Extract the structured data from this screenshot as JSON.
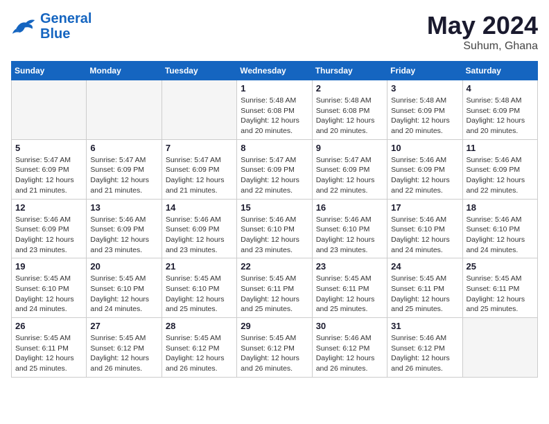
{
  "header": {
    "logo": {
      "line1": "General",
      "line2": "Blue"
    },
    "month": "May 2024",
    "location": "Suhum, Ghana"
  },
  "weekdays": [
    "Sunday",
    "Monday",
    "Tuesday",
    "Wednesday",
    "Thursday",
    "Friday",
    "Saturday"
  ],
  "weeks": [
    [
      {
        "day": "",
        "info": ""
      },
      {
        "day": "",
        "info": ""
      },
      {
        "day": "",
        "info": ""
      },
      {
        "day": "1",
        "info": "Sunrise: 5:48 AM\nSunset: 6:08 PM\nDaylight: 12 hours\nand 20 minutes."
      },
      {
        "day": "2",
        "info": "Sunrise: 5:48 AM\nSunset: 6:08 PM\nDaylight: 12 hours\nand 20 minutes."
      },
      {
        "day": "3",
        "info": "Sunrise: 5:48 AM\nSunset: 6:09 PM\nDaylight: 12 hours\nand 20 minutes."
      },
      {
        "day": "4",
        "info": "Sunrise: 5:48 AM\nSunset: 6:09 PM\nDaylight: 12 hours\nand 20 minutes."
      }
    ],
    [
      {
        "day": "5",
        "info": "Sunrise: 5:47 AM\nSunset: 6:09 PM\nDaylight: 12 hours\nand 21 minutes."
      },
      {
        "day": "6",
        "info": "Sunrise: 5:47 AM\nSunset: 6:09 PM\nDaylight: 12 hours\nand 21 minutes."
      },
      {
        "day": "7",
        "info": "Sunrise: 5:47 AM\nSunset: 6:09 PM\nDaylight: 12 hours\nand 21 minutes."
      },
      {
        "day": "8",
        "info": "Sunrise: 5:47 AM\nSunset: 6:09 PM\nDaylight: 12 hours\nand 22 minutes."
      },
      {
        "day": "9",
        "info": "Sunrise: 5:47 AM\nSunset: 6:09 PM\nDaylight: 12 hours\nand 22 minutes."
      },
      {
        "day": "10",
        "info": "Sunrise: 5:46 AM\nSunset: 6:09 PM\nDaylight: 12 hours\nand 22 minutes."
      },
      {
        "day": "11",
        "info": "Sunrise: 5:46 AM\nSunset: 6:09 PM\nDaylight: 12 hours\nand 22 minutes."
      }
    ],
    [
      {
        "day": "12",
        "info": "Sunrise: 5:46 AM\nSunset: 6:09 PM\nDaylight: 12 hours\nand 23 minutes."
      },
      {
        "day": "13",
        "info": "Sunrise: 5:46 AM\nSunset: 6:09 PM\nDaylight: 12 hours\nand 23 minutes."
      },
      {
        "day": "14",
        "info": "Sunrise: 5:46 AM\nSunset: 6:09 PM\nDaylight: 12 hours\nand 23 minutes."
      },
      {
        "day": "15",
        "info": "Sunrise: 5:46 AM\nSunset: 6:10 PM\nDaylight: 12 hours\nand 23 minutes."
      },
      {
        "day": "16",
        "info": "Sunrise: 5:46 AM\nSunset: 6:10 PM\nDaylight: 12 hours\nand 23 minutes."
      },
      {
        "day": "17",
        "info": "Sunrise: 5:46 AM\nSunset: 6:10 PM\nDaylight: 12 hours\nand 24 minutes."
      },
      {
        "day": "18",
        "info": "Sunrise: 5:46 AM\nSunset: 6:10 PM\nDaylight: 12 hours\nand 24 minutes."
      }
    ],
    [
      {
        "day": "19",
        "info": "Sunrise: 5:45 AM\nSunset: 6:10 PM\nDaylight: 12 hours\nand 24 minutes."
      },
      {
        "day": "20",
        "info": "Sunrise: 5:45 AM\nSunset: 6:10 PM\nDaylight: 12 hours\nand 24 minutes."
      },
      {
        "day": "21",
        "info": "Sunrise: 5:45 AM\nSunset: 6:10 PM\nDaylight: 12 hours\nand 25 minutes."
      },
      {
        "day": "22",
        "info": "Sunrise: 5:45 AM\nSunset: 6:11 PM\nDaylight: 12 hours\nand 25 minutes."
      },
      {
        "day": "23",
        "info": "Sunrise: 5:45 AM\nSunset: 6:11 PM\nDaylight: 12 hours\nand 25 minutes."
      },
      {
        "day": "24",
        "info": "Sunrise: 5:45 AM\nSunset: 6:11 PM\nDaylight: 12 hours\nand 25 minutes."
      },
      {
        "day": "25",
        "info": "Sunrise: 5:45 AM\nSunset: 6:11 PM\nDaylight: 12 hours\nand 25 minutes."
      }
    ],
    [
      {
        "day": "26",
        "info": "Sunrise: 5:45 AM\nSunset: 6:11 PM\nDaylight: 12 hours\nand 25 minutes."
      },
      {
        "day": "27",
        "info": "Sunrise: 5:45 AM\nSunset: 6:12 PM\nDaylight: 12 hours\nand 26 minutes."
      },
      {
        "day": "28",
        "info": "Sunrise: 5:45 AM\nSunset: 6:12 PM\nDaylight: 12 hours\nand 26 minutes."
      },
      {
        "day": "29",
        "info": "Sunrise: 5:45 AM\nSunset: 6:12 PM\nDaylight: 12 hours\nand 26 minutes."
      },
      {
        "day": "30",
        "info": "Sunrise: 5:46 AM\nSunset: 6:12 PM\nDaylight: 12 hours\nand 26 minutes."
      },
      {
        "day": "31",
        "info": "Sunrise: 5:46 AM\nSunset: 6:12 PM\nDaylight: 12 hours\nand 26 minutes."
      },
      {
        "day": "",
        "info": ""
      }
    ]
  ]
}
